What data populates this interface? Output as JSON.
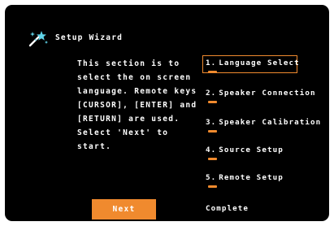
{
  "wizard": {
    "title": "Setup Wizard",
    "icon": "magic-wand-icon",
    "description": "This section is to\nselect the on screen\nlanguage. Remote keys\n[CURSOR], [ENTER] and\n[RETURN] are used.\nSelect 'Next' to\nstart."
  },
  "steps": [
    {
      "number": "1.",
      "label": "Language Select",
      "active": true
    },
    {
      "number": "2.",
      "label": "Speaker Connection",
      "active": false
    },
    {
      "number": "3.",
      "label": "Speaker Calibration",
      "active": false
    },
    {
      "number": "4.",
      "label": "Source Setup",
      "active": false
    },
    {
      "number": "5.",
      "label": "Remote Setup",
      "active": false
    }
  ],
  "complete_label": "Complete",
  "next_button": {
    "label": "Next"
  },
  "colors": {
    "background": "#000000",
    "accent": "#f08a2e",
    "text": "#ffffff",
    "wand_star": "#5fd3e8"
  }
}
